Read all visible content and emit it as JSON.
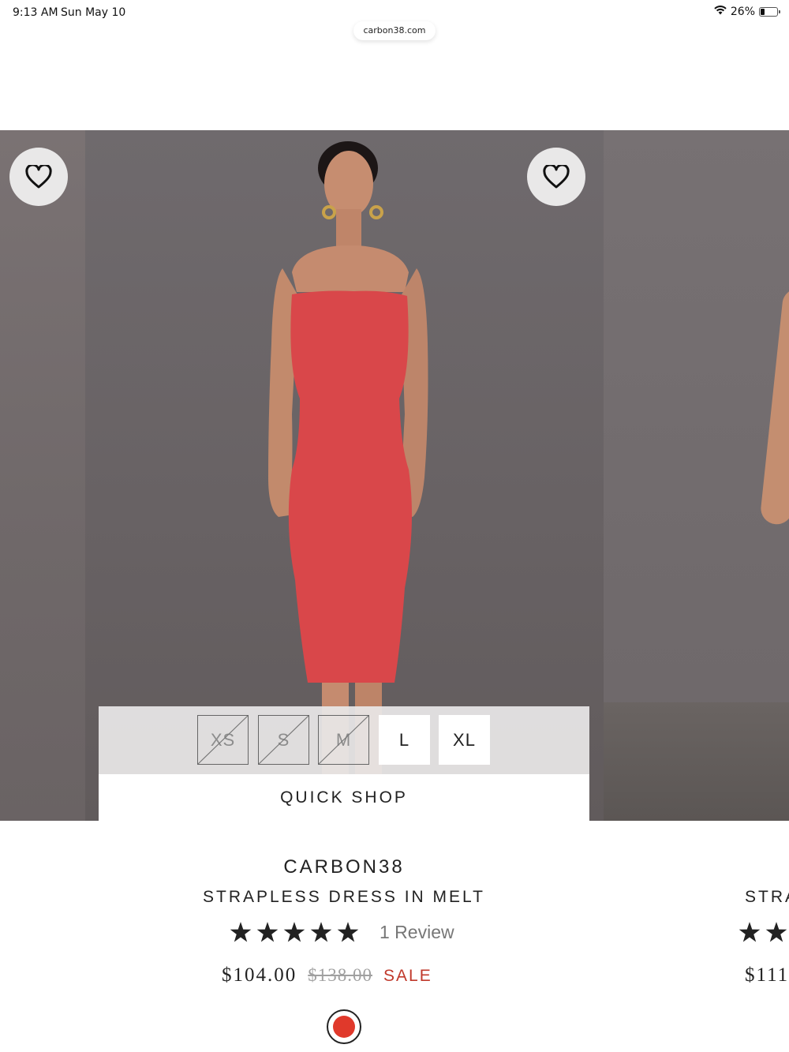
{
  "status_bar": {
    "time": "9:13 AM",
    "date": "Sun May 10",
    "battery": "26%",
    "battery_level": 0.26
  },
  "browser": {
    "url": "carbon38.com"
  },
  "product": {
    "brand": "CARBON38",
    "name": "STRAPLESS DRESS IN MELT",
    "rating": 5,
    "reviews": "1 Review",
    "price": "$104.00",
    "original_price": "$138.00",
    "sale_label": "SALE",
    "quick_shop_label": "QUICK SHOP",
    "sizes": [
      {
        "label": "XS",
        "available": false
      },
      {
        "label": "S",
        "available": false
      },
      {
        "label": "M",
        "available": false
      },
      {
        "label": "L",
        "available": true
      },
      {
        "label": "XL",
        "available": true
      }
    ],
    "swatch_color": "#e0392b"
  },
  "next_product": {
    "name_partial": "STRA",
    "price_partial": "$111"
  },
  "colors": {
    "dress": "#d9474a",
    "sale": "#c0392b",
    "star": "#222222"
  }
}
